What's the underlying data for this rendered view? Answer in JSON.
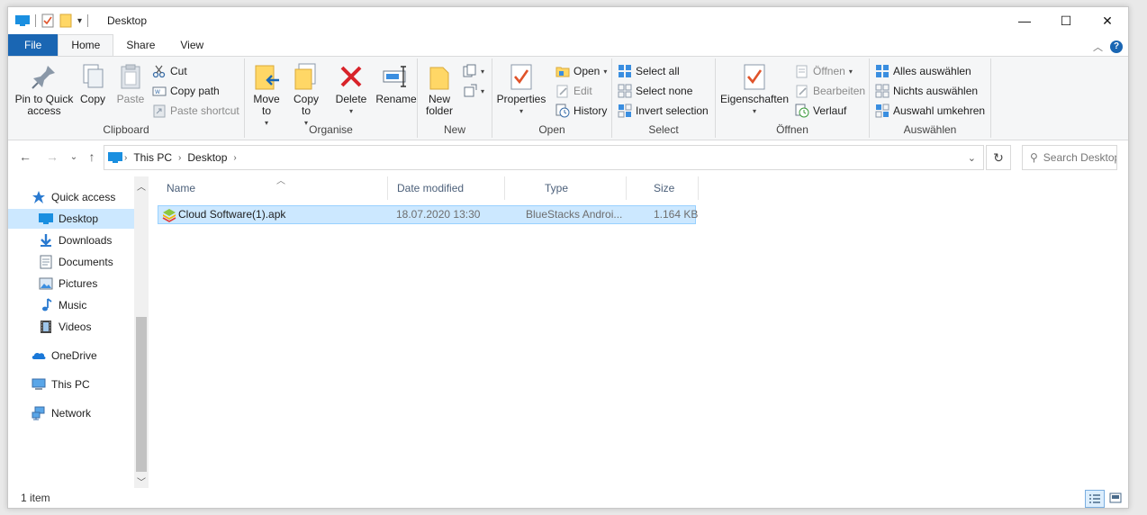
{
  "window": {
    "title": "Desktop"
  },
  "ribbon_tabs": [
    "File",
    "Home",
    "Share",
    "View"
  ],
  "ribbon": {
    "clipboard": {
      "label": "Clipboard",
      "pin": "Pin to Quick access",
      "copy": "Copy",
      "paste": "Paste",
      "cut": "Cut",
      "copy_path": "Copy path",
      "paste_shortcut": "Paste shortcut"
    },
    "organise": {
      "label": "Organise",
      "move_to": "Move to",
      "copy_to": "Copy to",
      "delete": "Delete",
      "rename": "Rename"
    },
    "new": {
      "label": "New",
      "new_folder": "New folder"
    },
    "open": {
      "label": "Open",
      "properties": "Properties",
      "open": "Open",
      "edit": "Edit",
      "history": "History"
    },
    "select": {
      "label": "Select",
      "select_all": "Select all",
      "select_none": "Select none",
      "invert": "Invert selection"
    },
    "oeffnen": {
      "label": "Öffnen",
      "eigenschaften": "Eigenschaften",
      "oeffnen": "Öffnen",
      "bearbeiten": "Bearbeiten",
      "verlauf": "Verlauf"
    },
    "auswaehlen": {
      "label": "Auswählen",
      "alles": "Alles auswählen",
      "nichts": "Nichts auswählen",
      "umkehren": "Auswahl umkehren"
    }
  },
  "address": {
    "segments": [
      "This PC",
      "Desktop"
    ],
    "search_placeholder": "Search Desktop"
  },
  "nav_pane": {
    "quick_access": "Quick access",
    "items": [
      "Desktop",
      "Downloads",
      "Documents",
      "Pictures",
      "Music",
      "Videos"
    ],
    "onedrive": "OneDrive",
    "this_pc": "This PC",
    "network": "Network"
  },
  "columns": [
    "Name",
    "Date modified",
    "Type",
    "Size"
  ],
  "files": [
    {
      "name": "Cloud Software(1).apk",
      "date": "18.07.2020 13:30",
      "type": "BlueStacks Androi...",
      "size": "1.164 KB"
    }
  ],
  "status": {
    "item_count": "1 item"
  },
  "colors": {
    "accent": "#1a66b3",
    "selection": "#cce8ff",
    "selection_border": "#99d1ff"
  }
}
